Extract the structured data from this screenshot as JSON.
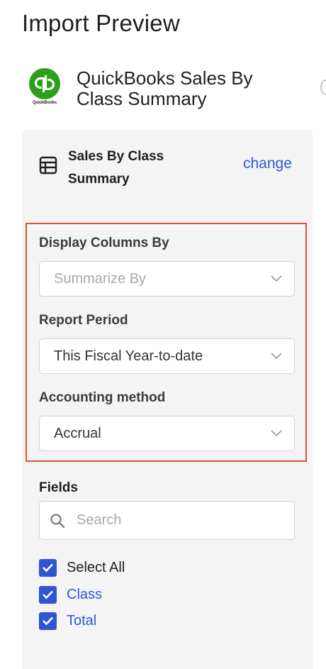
{
  "page": {
    "title": "Import Preview"
  },
  "source": {
    "logo_text": "QuickBooks",
    "name": "QuickBooks Sales By Class Summary"
  },
  "report": {
    "name": "Sales By Class Summary",
    "change_label": "change",
    "icon": "table-icon"
  },
  "options": {
    "display_columns": {
      "label": "Display Columns By",
      "placeholder": "Summarize By",
      "value": ""
    },
    "report_period": {
      "label": "Report Period",
      "value": "This Fiscal Year-to-date"
    },
    "accounting_method": {
      "label": "Accounting method",
      "value": "Accrual"
    }
  },
  "fields": {
    "label": "Fields",
    "search_placeholder": "Search",
    "select_all_label": "Select All",
    "items": [
      {
        "label": "Class",
        "checked": true
      },
      {
        "label": "Total",
        "checked": true
      }
    ]
  },
  "colors": {
    "accent": "#2a5bd7",
    "checkbox": "#2f55d4",
    "highlight_border": "#d9533f",
    "quickbooks_green": "#2ca01c",
    "panel_bg": "#f4f4f5"
  }
}
